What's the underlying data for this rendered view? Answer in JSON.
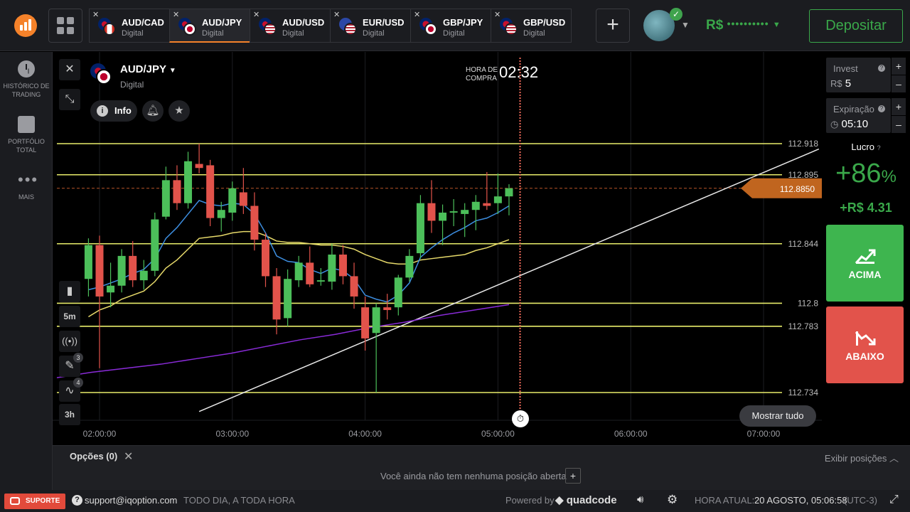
{
  "colors": {
    "brand": "#f5822a",
    "green": "#3aa84a",
    "red": "#e2534b",
    "panel": "#1b1c20",
    "level_line": "#e8ec6a",
    "ema_fast": "#3d8ee0",
    "ema_slow": "#e6d96a",
    "ema_long": "#8a2bd9"
  },
  "header": {
    "tabs": [
      {
        "pair": "AUD/CAD",
        "type": "Digital",
        "active": false
      },
      {
        "pair": "AUD/JPY",
        "type": "Digital",
        "active": true
      },
      {
        "pair": "AUD/USD",
        "type": "Digital",
        "active": false
      },
      {
        "pair": "EUR/USD",
        "type": "Digital",
        "active": false
      },
      {
        "pair": "GBP/JPY",
        "type": "Digital",
        "active": false
      },
      {
        "pair": "GBP/USD",
        "type": "Digital",
        "active": false
      }
    ],
    "balance_currency": "R$",
    "balance_masked": "••••••••••",
    "deposit_label": "Depositar"
  },
  "sidebar": {
    "items": [
      {
        "label": "Histórico de trading",
        "icon": "clock-icon"
      },
      {
        "label": "Portfólio total",
        "icon": "briefcase-icon"
      },
      {
        "label": "Mais",
        "icon": "more-dots-icon"
      }
    ]
  },
  "chart": {
    "asset": "AUD/JPY",
    "asset_type": "Digital",
    "info_label": "Info",
    "purchase_label": "Hora de compra",
    "purchase_time": "02:32",
    "show_all_label": "Mostrar tudo",
    "timeframe_candle": "5m",
    "timeframe_range": "3h",
    "drawing_count": "3",
    "indicator_count": "4"
  },
  "chart_data": {
    "type": "candlestick",
    "x_ticks": [
      "02:00:00",
      "03:00:00",
      "04:00:00",
      "05:00:00",
      "06:00:00",
      "07:00:00"
    ],
    "price_levels": [
      112.918,
      112.895,
      112.844,
      112.8,
      112.783,
      112.734
    ],
    "current_price": "112.8850",
    "candles": [
      {
        "t": "01:55",
        "o": 112.818,
        "h": 112.848,
        "l": 112.805,
        "c": 112.843
      },
      {
        "t": "02:00",
        "o": 112.843,
        "h": 112.85,
        "l": 112.752,
        "c": 112.805
      },
      {
        "t": "02:05",
        "o": 112.808,
        "h": 112.83,
        "l": 112.797,
        "c": 112.813
      },
      {
        "t": "02:10",
        "o": 112.813,
        "h": 112.84,
        "l": 112.808,
        "c": 112.835
      },
      {
        "t": "02:15",
        "o": 112.835,
        "h": 112.846,
        "l": 112.812,
        "c": 112.817
      },
      {
        "t": "02:20",
        "o": 112.817,
        "h": 112.832,
        "l": 112.81,
        "c": 112.824
      },
      {
        "t": "02:25",
        "o": 112.824,
        "h": 112.867,
        "l": 112.82,
        "c": 112.862
      },
      {
        "t": "02:30",
        "o": 112.864,
        "h": 112.901,
        "l": 112.862,
        "c": 112.891
      },
      {
        "t": "02:35",
        "o": 112.891,
        "h": 112.902,
        "l": 112.869,
        "c": 112.874
      },
      {
        "t": "02:40",
        "o": 112.874,
        "h": 112.912,
        "l": 112.87,
        "c": 112.905
      },
      {
        "t": "02:45",
        "o": 112.903,
        "h": 112.918,
        "l": 112.896,
        "c": 112.9
      },
      {
        "t": "02:50",
        "o": 112.902,
        "h": 112.906,
        "l": 112.857,
        "c": 112.863
      },
      {
        "t": "02:55",
        "o": 112.863,
        "h": 112.875,
        "l": 112.853,
        "c": 112.869
      },
      {
        "t": "03:00",
        "o": 112.867,
        "h": 112.89,
        "l": 112.861,
        "c": 112.885
      },
      {
        "t": "03:05",
        "o": 112.882,
        "h": 112.9,
        "l": 112.866,
        "c": 112.872
      },
      {
        "t": "03:10",
        "o": 112.872,
        "h": 112.882,
        "l": 112.839,
        "c": 112.847
      },
      {
        "t": "03:15",
        "o": 112.847,
        "h": 112.852,
        "l": 112.812,
        "c": 112.82
      },
      {
        "t": "03:20",
        "o": 112.82,
        "h": 112.826,
        "l": 112.777,
        "c": 112.788
      },
      {
        "t": "03:25",
        "o": 112.789,
        "h": 112.825,
        "l": 112.783,
        "c": 112.818
      },
      {
        "t": "03:30",
        "o": 112.817,
        "h": 112.835,
        "l": 112.812,
        "c": 112.83
      },
      {
        "t": "03:35",
        "o": 112.83,
        "h": 112.842,
        "l": 112.812,
        "c": 112.814
      },
      {
        "t": "03:40",
        "o": 112.816,
        "h": 112.826,
        "l": 112.813,
        "c": 112.817
      },
      {
        "t": "03:45",
        "o": 112.816,
        "h": 112.844,
        "l": 112.81,
        "c": 112.836
      },
      {
        "t": "03:50",
        "o": 112.836,
        "h": 112.843,
        "l": 112.814,
        "c": 112.82
      },
      {
        "t": "03:55",
        "o": 112.82,
        "h": 112.83,
        "l": 112.796,
        "c": 112.805
      },
      {
        "t": "04:00",
        "o": 112.797,
        "h": 112.805,
        "l": 112.765,
        "c": 112.774
      },
      {
        "t": "04:05",
        "o": 112.778,
        "h": 112.8,
        "l": 112.734,
        "c": 112.797
      },
      {
        "t": "04:10",
        "o": 112.797,
        "h": 112.807,
        "l": 112.788,
        "c": 112.795
      },
      {
        "t": "04:15",
        "o": 112.797,
        "h": 112.821,
        "l": 112.791,
        "c": 112.819
      },
      {
        "t": "04:20",
        "o": 112.819,
        "h": 112.84,
        "l": 112.816,
        "c": 112.835
      },
      {
        "t": "04:25",
        "o": 112.837,
        "h": 112.88,
        "l": 112.833,
        "c": 112.874
      },
      {
        "t": "04:30",
        "o": 112.874,
        "h": 112.891,
        "l": 112.852,
        "c": 112.861
      },
      {
        "t": "04:35",
        "o": 112.861,
        "h": 112.873,
        "l": 112.843,
        "c": 112.867
      },
      {
        "t": "04:40",
        "o": 112.867,
        "h": 112.877,
        "l": 112.857,
        "c": 112.868
      },
      {
        "t": "04:45",
        "o": 112.866,
        "h": 112.874,
        "l": 112.849,
        "c": 112.869
      },
      {
        "t": "04:50",
        "o": 112.869,
        "h": 112.88,
        "l": 112.854,
        "c": 112.875
      },
      {
        "t": "04:55",
        "o": 112.874,
        "h": 112.897,
        "l": 112.869,
        "c": 112.872
      },
      {
        "t": "05:00",
        "o": 112.874,
        "h": 112.896,
        "l": 112.866,
        "c": 112.879
      },
      {
        "t": "05:05",
        "o": 112.879,
        "h": 112.888,
        "l": 112.865,
        "c": 112.885
      }
    ],
    "ema_fast": [
      112.81,
      112.812,
      112.815,
      112.818,
      112.822,
      112.825,
      112.833,
      112.848,
      112.856,
      112.866,
      112.876,
      112.873,
      112.872,
      112.874,
      112.873,
      112.866,
      112.852,
      112.835,
      112.831,
      112.83,
      112.825,
      112.822,
      112.826,
      112.824,
      112.818,
      112.806,
      112.803,
      112.801,
      112.806,
      112.815,
      112.834,
      112.841,
      112.847,
      112.852,
      112.856,
      112.861,
      112.863,
      112.867,
      112.872
    ],
    "ema_slow": [
      112.79,
      112.795,
      112.798,
      112.803,
      112.806,
      112.809,
      112.816,
      112.826,
      112.832,
      112.84,
      112.848,
      112.849,
      112.85,
      112.852,
      112.853,
      112.853,
      112.85,
      112.846,
      112.845,
      112.845,
      112.844,
      112.843,
      112.843,
      112.842,
      112.84,
      112.836,
      112.833,
      112.83,
      112.829,
      112.829,
      112.832,
      112.833,
      112.834,
      112.835,
      112.836,
      112.839,
      112.841,
      112.844,
      112.847
    ],
    "ema_long": [
      112.745,
      112.749,
      112.752,
      112.755,
      112.759,
      112.763,
      112.768,
      112.773,
      112.777,
      112.782,
      112.786,
      112.791,
      112.795,
      112.799
    ],
    "trendline": {
      "from": [
        "02:45",
        112.72
      ],
      "to": [
        "07:25",
        112.914
      ]
    }
  },
  "trade_panel": {
    "invest_label": "Invest",
    "invest_currency": "R$",
    "invest_value": "5",
    "expiry_label": "Expiração",
    "expiry_value": "05:10",
    "profit_label": "Lucro",
    "profit_pct": "+86",
    "profit_pct_sign": "%",
    "profit_amount": "+R$ 4.31",
    "call_label": "ACIMA",
    "put_label": "ABAIXO"
  },
  "options": {
    "title": "Opções (0)",
    "show_positions": "Exibir posições",
    "no_positions": "Você ainda não tem nenhuma posição aberta"
  },
  "statusbar": {
    "support_label": "SUPORTE",
    "email": "support@iqoption.com",
    "hours": "TODO DIA, A TODA HORA",
    "powered": "Powered by",
    "powered_brand": "quadcode",
    "time_label": "HORA ATUAL:",
    "time_value": "20 AGOSTO, 05:06:58",
    "timezone": "(UTC-3)"
  }
}
